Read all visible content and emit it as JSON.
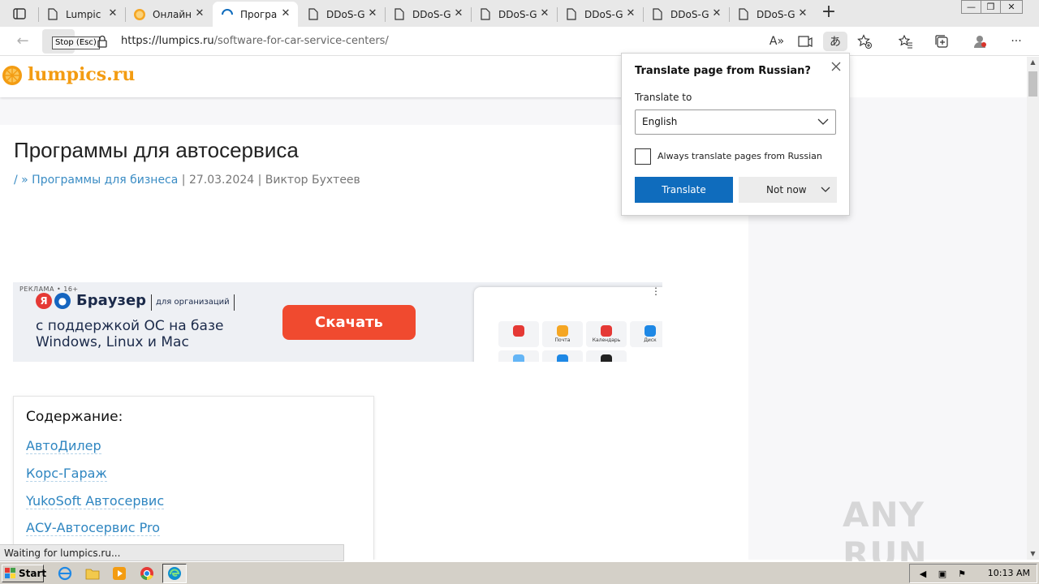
{
  "browser": {
    "tabs": [
      {
        "title": "Lumpic",
        "icon": "page-icon"
      },
      {
        "title": "Онлайн",
        "icon": "orange-icon"
      },
      {
        "title": "Програ",
        "icon": "loading-icon",
        "active": true
      },
      {
        "title": "DDoS-G",
        "icon": "page-icon"
      },
      {
        "title": "DDoS-G",
        "icon": "page-icon"
      },
      {
        "title": "DDoS-G",
        "icon": "page-icon"
      },
      {
        "title": "DDoS-G",
        "icon": "page-icon"
      },
      {
        "title": "DDoS-G",
        "icon": "page-icon"
      },
      {
        "title": "DDoS-G",
        "icon": "page-icon"
      }
    ],
    "tooltip": "Stop (Esc)",
    "url_host": "https://lumpics.ru",
    "url_path": "/software-for-car-service-centers/",
    "status_text": "Waiting for lumpics.ru..."
  },
  "site": {
    "logo": "lumpics.ru"
  },
  "article": {
    "title": "Программы для автосервиса",
    "meta_breadcrumb": "/ » Программы для бизнеса",
    "meta_date": "27.03.2024",
    "meta_author": "Виктор Бухтеев"
  },
  "ad": {
    "mark": "РЕКЛАМА • 16+",
    "brand": "Браузер",
    "org": "для организаций",
    "line1": "с поддержкой ОС на базе",
    "line2": "Windows, Linux и Mac",
    "cta": "Скачать",
    "tiles": [
      "Почта",
      "Календарь",
      "Диск"
    ]
  },
  "toc": {
    "title": "Содержание:",
    "items": [
      "АвтоДилер",
      "Корс-Гараж",
      "YukoSoft Автосервис",
      "АСУ-Автосервис Pro"
    ]
  },
  "translate_popup": {
    "title": "Translate page from Russian?",
    "label": "Translate to",
    "selected_language": "English",
    "always_label": "Always translate pages from Russian",
    "always_checked": false,
    "translate_btn": "Translate",
    "not_now_btn": "Not now"
  },
  "watermark": "ANY RUN",
  "taskbar": {
    "start": "Start",
    "clock": "10:13 AM"
  },
  "colors": {
    "brand_orange": "#f39c12",
    "link_blue": "#2f86c1",
    "translate_blue": "#0f6cbd",
    "ad_cta": "#f04a2f"
  }
}
